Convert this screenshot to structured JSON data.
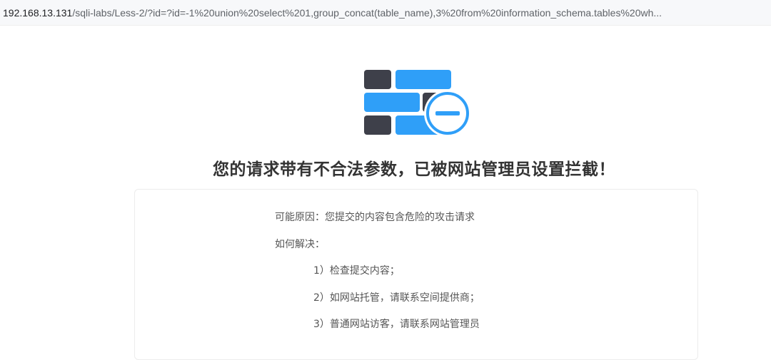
{
  "address_bar": {
    "host": "192.168.13.131",
    "path": "/sqli-labs/Less-2/?id=?id=-1%20union%20select%201,group_concat(table_name),3%20from%20information_schema.tables%20wh..."
  },
  "icon": {
    "name": "firewall-block-icon",
    "colors": {
      "dark_brick": "#3e404a",
      "blue_brick": "#2f9ff8",
      "badge_ring": "#2f9ff8",
      "badge_fill": "#ffffff"
    }
  },
  "block_page": {
    "title": "您的请求带有不合法参数，已被网站管理员设置拦截！",
    "reason": "可能原因：您提交的内容包含危险的攻击请求",
    "how_to_resolve": "如何解决：",
    "steps": [
      "1）检查提交内容；",
      "2）如网站托管，请联系空间提供商；",
      "3）普通网站访客，请联系网站管理员"
    ]
  }
}
